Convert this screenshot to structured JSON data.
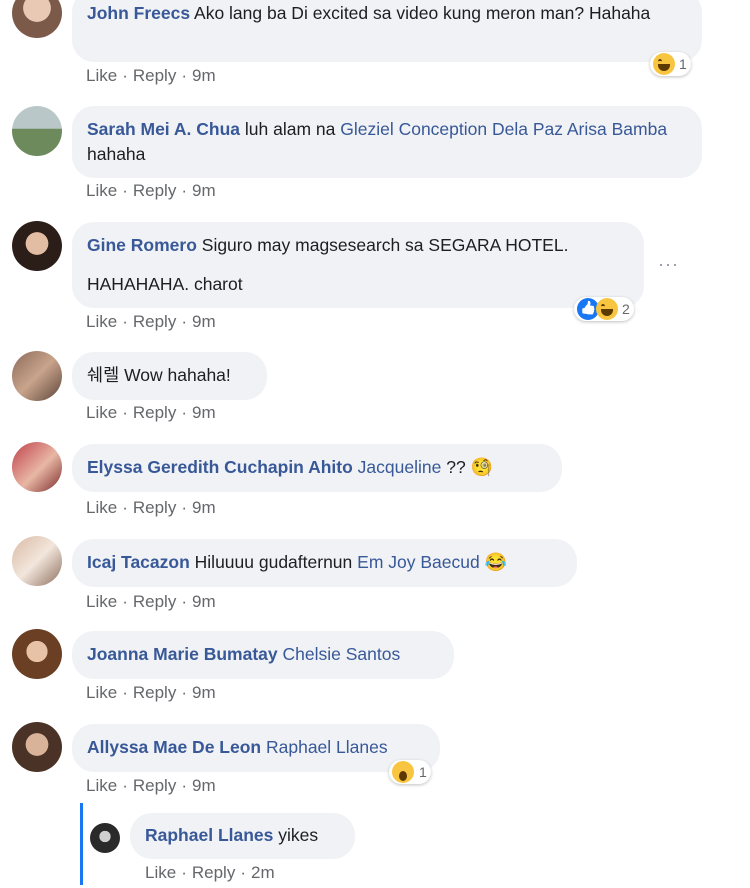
{
  "action_labels": {
    "like": "Like",
    "reply": "Reply",
    "sep": "·"
  },
  "comments": [
    {
      "name": "John Freecs",
      "text": "Ako lang ba Di excited sa video kung meron man? Hahaha",
      "time": "9m",
      "reaction_count": "1",
      "reaction": "haha-icon"
    },
    {
      "name": "Sarah Mei A. Chua",
      "pre": "luh alam na ",
      "mention": "Gleziel Conception Dela Paz Arisa Bamba",
      "post": " hahaha",
      "time": "9m"
    },
    {
      "name": "Gine Romero",
      "line1": "Siguro may magsesearch sa SEGARA HOTEL.",
      "line2": "HAHAHAHA. charot",
      "time": "9m",
      "reaction_count": "2",
      "more": "···"
    },
    {
      "name": "쉐렐",
      "text": "Wow hahaha!",
      "time": "9m"
    },
    {
      "name": "Elyssa Geredith Cuchapin Ahito",
      "mention": "Jacqueline",
      "post": " ?? ",
      "emoji": "🧐",
      "time": "9m"
    },
    {
      "name": "Icaj Tacazon",
      "pre": "Hiluuuu gudafternun ",
      "mention": "Em Joy Baecud",
      "emoji": "😂",
      "time": "9m"
    },
    {
      "name": "Joanna Marie Bumatay",
      "mention": "Chelsie Santos",
      "time": "9m"
    },
    {
      "name": "Allyssa Mae De Leon",
      "mention": "Raphael Llanes",
      "time": "9m",
      "reaction_count": "1",
      "reaction": "wow-icon"
    }
  ],
  "reply": {
    "name": "Raphael Llanes",
    "text": "yikes",
    "time": "2m"
  },
  "colors": {
    "link": "#385898",
    "bubble": "#f0f2f5",
    "thread": "#1877f2"
  }
}
